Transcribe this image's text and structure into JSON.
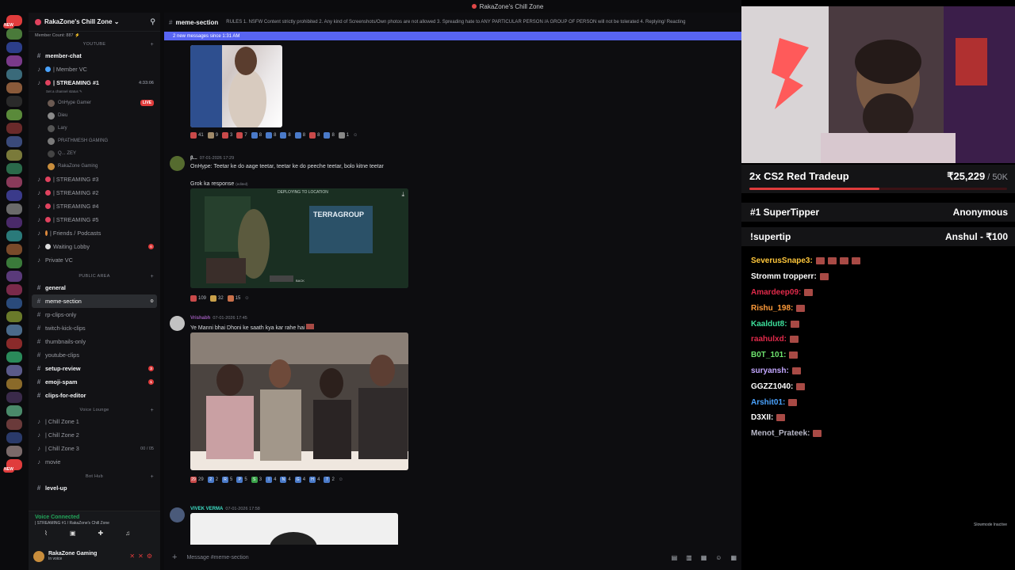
{
  "window": {
    "title": "RakaZone's Chill Zone"
  },
  "rail": {
    "badges": [
      "NEW",
      "",
      "",
      "",
      "",
      "",
      "",
      "",
      "",
      "",
      "",
      "",
      "",
      "",
      "",
      "",
      "",
      "",
      "",
      "",
      "",
      "",
      "",
      "",
      "",
      "",
      "",
      "",
      "",
      "",
      "",
      "",
      "",
      "NEW"
    ]
  },
  "sidebar": {
    "guild_name": "RakaZone's Chill Zone ⌄",
    "categories": {
      "youtube": "YOUTUBE",
      "public_area": "PUBLIC AREA",
      "voice_lounge": "Voice Lounge",
      "bot_hub": "Bot Hub"
    },
    "items": {
      "member_count": "Member Count: 887 ⚡",
      "member_chat": "member-chat",
      "member_vc": "| Member VC",
      "streaming1": "| STREAMING #1",
      "streaming1_time": "4:33:06",
      "set_status": "Set a channel status ✎",
      "live": "LIVE",
      "users": [
        "OnHype Gamer",
        "Dieu",
        "Lary",
        "PRATHMESH GAMING",
        "Q...  ZEY",
        "RakaZone Gaming"
      ],
      "streaming3": "| STREAMING #3",
      "streaming2": "| STREAMING #2",
      "streaming4": "| STREAMING #4",
      "streaming5": "| STREAMING #5",
      "friends": "| Friends / Podcasts",
      "waiting": "Waiting Lobby",
      "waiting_badge": "6",
      "private_vc": "Private VC",
      "general": "general",
      "meme_section": "meme-section",
      "rp_clips": "rp-clips-only",
      "twitch_kick": "twitch-kick-clips",
      "thumbnails": "thumbnails-only",
      "youtube_clips": "youtube-clips",
      "setup_review": "setup-review",
      "setup_badge": "3",
      "emoji_spam": "emoji-spam",
      "emoji_badge": "1",
      "clips_editor": "clips-for-editor",
      "chill1": "| Chill Zone 1",
      "chill2": "| Chill Zone 2",
      "chill3": "| Chill Zone 3",
      "chill3_count": "00 / 05",
      "movie": "movie",
      "level_up": "level-up"
    },
    "voice": {
      "status": "Voice Connected",
      "sub": "| STREAMING #1 / RakaZone's Chill Zone"
    },
    "user": {
      "name": "RakaZone Gaming",
      "status": "In voice"
    }
  },
  "main": {
    "channel": "meme-section",
    "topic": "RULES 1. NSFW Content strictly prohibited 2. Any kind of Screenshots/Own photos are not allowed 3. Spreading hate to ANY PARTICULAR PERSON /A GROUP OF PERSON will not be tolerated 4. Replying/ Reacting",
    "new_messages": "2 new messages since 1:31 AM",
    "reactions1": [
      "41",
      "9",
      "3",
      "7",
      "8",
      "8",
      "8",
      "8",
      "8",
      "8",
      "1"
    ],
    "msg2": {
      "author": "β...",
      "time": "07-01-2026 17:29",
      "text": "OnHype: Teetar ke do aage teetar, teetar ke do peeche teetar, bolo kitne teetar",
      "caption": "Grok ka response",
      "edited": "(edited)",
      "img_text": "DEPLOYING TO LOCATION",
      "img_brand": "TERRAGROUP",
      "img_back": "BACK"
    },
    "reactions2": [
      "109",
      "32",
      "15"
    ],
    "msg3": {
      "author": "Vrishabh",
      "time": "07-01-2026 17:45",
      "text": "Ye Manni bhai Dhoni ke saath kya kar rahe hai"
    },
    "reactions3": [
      "29",
      "2",
      "R",
      "P",
      "S",
      "I",
      "N",
      "G",
      "H",
      "7"
    ],
    "reactions3_counts": [
      "29",
      "2",
      "5",
      "5",
      "3",
      "4",
      "4",
      "4",
      "4",
      "2"
    ],
    "msg4": {
      "author": "VIVEK VERMA",
      "time": "07-01-2026 17:58"
    },
    "composer_placeholder": "Message #meme-section",
    "slowmode": "Slowmode Inactive"
  },
  "overlay": {
    "tradeup_title": "2x CS2 Red Tradeup",
    "tradeup_amount": "₹25,229",
    "tradeup_goal": " / 50K",
    "tradeup_progress": 0.5046,
    "supertipper_label": "#1 SuperTipper",
    "supertipper_name": "Anonymous",
    "supertip_cmd": "!supertip",
    "supertip_value": "Anshul - ₹100",
    "chat": [
      {
        "name": "SeverusSnape3:",
        "color": "#ffc73b",
        "emotes": 4
      },
      {
        "name": "Stromm tropperr:",
        "color": "#ffffff",
        "emotes": 1
      },
      {
        "name": "Amardeep09:",
        "color": "#e02a4a",
        "emotes": 1
      },
      {
        "name": "Rishu_198:",
        "color": "#ff9b3a",
        "emotes": 1
      },
      {
        "name": "Kaaldut8:",
        "color": "#3ddf9b",
        "emotes": 1
      },
      {
        "name": "raahulxd:",
        "color": "#e02a4a",
        "emotes": 1
      },
      {
        "name": "B0T_101:",
        "color": "#6ee36e",
        "emotes": 1
      },
      {
        "name": "suryansh:",
        "color": "#c3a7ff",
        "emotes": 1
      },
      {
        "name": "GGZZ1040:",
        "color": "#ffffff",
        "emotes": 1
      },
      {
        "name": "Arshit01:",
        "color": "#4aa3ff",
        "emotes": 1
      },
      {
        "name": "D3XII:",
        "color": "#ffffff",
        "emotes": 1
      },
      {
        "name": "Menot_Prateek:",
        "color": "#b9b9c8",
        "emotes": 1
      }
    ]
  }
}
